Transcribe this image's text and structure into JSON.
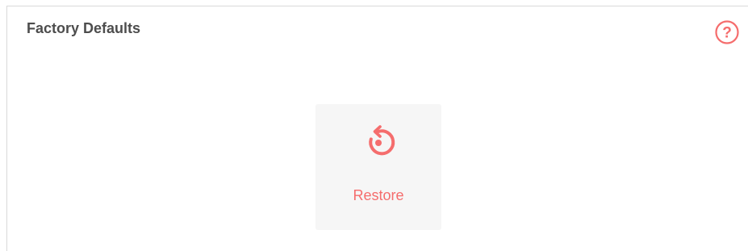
{
  "section": {
    "title": "Factory Defaults"
  },
  "help": {
    "icon": "help-icon",
    "glyph": "?"
  },
  "restore": {
    "label": "Restore",
    "icon": "restore-icon"
  },
  "colors": {
    "accent": "#f56d6d",
    "title_text": "#4d4d4d",
    "tile_background": "#f6f6f6",
    "border": "#d9d9d9"
  }
}
